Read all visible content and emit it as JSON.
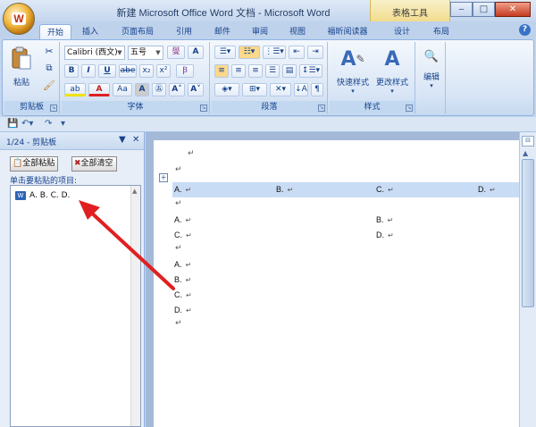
{
  "window": {
    "title": "新建 Microsoft Office Word 文档 - Microsoft Word",
    "context_tab": "表格工具",
    "minimize": "‒",
    "maximize": "□",
    "close": "✕"
  },
  "tabs": [
    "开始",
    "插入",
    "页面布局",
    "引用",
    "邮件",
    "审阅",
    "视图",
    "福昕阅读器",
    "设计",
    "布局"
  ],
  "ribbon": {
    "clipboard": {
      "label": "剪贴板",
      "paste": "粘贴"
    },
    "font": {
      "label": "字体",
      "font_name": "Calibri (西文)",
      "font_size": "五号",
      "bold": "B",
      "italic": "I",
      "underline": "U",
      "strike": "abe",
      "subscript": "x₂",
      "superscript": "x²",
      "grow": "A",
      "aa": "Aa"
    },
    "paragraph": {
      "label": "段落"
    },
    "styles": {
      "label": "样式",
      "quick_styles": "快速样式",
      "change_styles": "更改样式"
    },
    "editing": {
      "label": "编辑"
    }
  },
  "clipboard_pane": {
    "title": "1/24 - 剪贴板",
    "paste_all": "全部粘贴",
    "clear_all": "全部清空",
    "hint": "单击要粘贴的项目:",
    "item": "A.  B.  C.  D."
  },
  "document": {
    "table_row": [
      "A.",
      "B.",
      "C.",
      "D."
    ],
    "row_a": [
      "A.",
      "B."
    ],
    "row_b": [
      "C.",
      "D."
    ],
    "list": [
      "A.",
      "B.",
      "C.",
      "D."
    ],
    "para_mark": "↵"
  },
  "colors": {
    "accent": "#15428b",
    "arrow": "#e02020",
    "selection": "#c9dcf5"
  }
}
